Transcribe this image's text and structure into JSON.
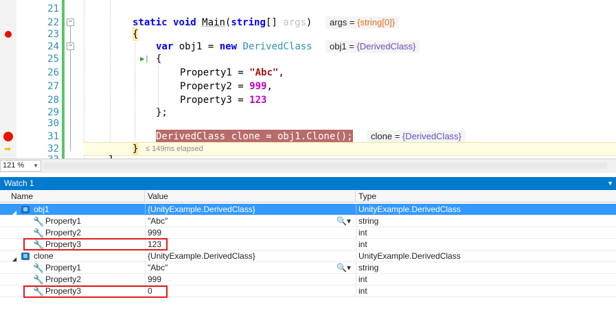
{
  "editor": {
    "lines": [
      {
        "num": "21"
      },
      {
        "num": "22",
        "kw1": "static",
        "kw2": "void",
        "name": "Main",
        "paren_open": "(",
        "kw3": "string",
        "brackets": "[] ",
        "param": "args",
        "paren_close": ")",
        "tip_label": "args = ",
        "tip_value": "{string[0]}"
      },
      {
        "num": "23",
        "text": "{"
      },
      {
        "num": "24",
        "kw": "var",
        "mid": " obj1 = ",
        "kw_new": "new",
        "type": " DerivedClass",
        "tip_label": "obj1 = ",
        "tip_value": "{DerivedClass}"
      },
      {
        "num": "25",
        "text": "{"
      },
      {
        "num": "26",
        "prop": "Property1 = ",
        "val": "\"Abc\"",
        "tail": ","
      },
      {
        "num": "27",
        "prop": "Property2 = ",
        "val": "999",
        "tail": ","
      },
      {
        "num": "28",
        "prop": "Property3 = ",
        "val": "123"
      },
      {
        "num": "29",
        "text": "};"
      },
      {
        "num": "30"
      },
      {
        "num": "31",
        "text": "DerivedClass clone = obj1.Clone();",
        "tip_label": "clone = ",
        "tip_value": "{DerivedClass}"
      },
      {
        "num": "32",
        "text": "}",
        "elapsed": "≤ 149ms elapsed"
      },
      {
        "num": "33",
        "text": "}"
      }
    ]
  },
  "zoom": {
    "value": "121 %"
  },
  "watch": {
    "title": "Watch 1",
    "headers": {
      "name": "Name",
      "value": "Value",
      "type": "Type"
    },
    "rows": [
      {
        "name": "obj1",
        "value": "{UnityExample.DerivedClass}",
        "type": "UnityExample.DerivedClass"
      },
      {
        "name": "Property1",
        "value": "\"Abc\"",
        "type": "string"
      },
      {
        "name": "Property2",
        "value": "999",
        "type": "int"
      },
      {
        "name": "Property3",
        "value": "123",
        "type": "int"
      },
      {
        "name": "clone",
        "value": "{UnityExample.DerivedClass}",
        "type": "UnityExample.DerivedClass"
      },
      {
        "name": "Property1",
        "value": "\"Abc\"",
        "type": "string"
      },
      {
        "name": "Property2",
        "value": "999",
        "type": "int"
      },
      {
        "name": "Property3",
        "value": "0",
        "type": "int"
      }
    ]
  },
  "colors": {
    "accent": "#007acc",
    "selection": "#3399ff",
    "breakpoint": "#e51400",
    "annotation": "#e01b1b"
  }
}
